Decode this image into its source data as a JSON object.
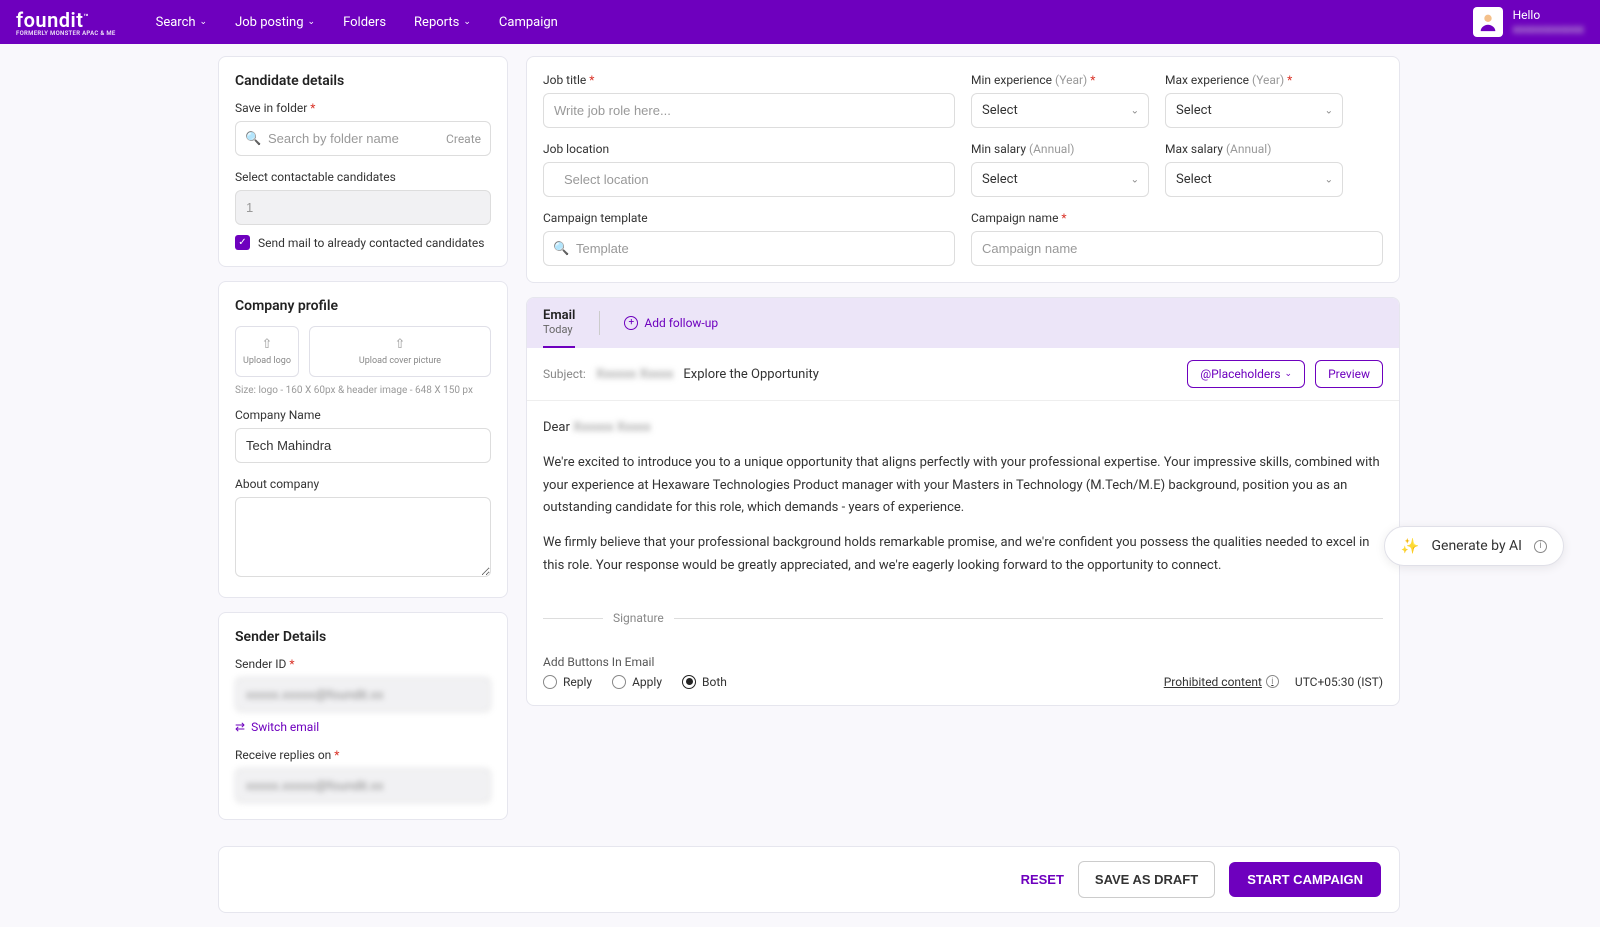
{
  "brand": {
    "name": "foundit",
    "tagline": "FORMERLY MONSTER APAC & ME"
  },
  "nav": {
    "search": "Search",
    "jobposting": "Job posting",
    "folders": "Folders",
    "reports": "Reports",
    "campaign": "Campaign"
  },
  "profile": {
    "greeting": "Hello",
    "name_blurred": "xxxxxxxxxxxx"
  },
  "left": {
    "candidate": {
      "title": "Candidate details",
      "save_label": "Save in folder",
      "search_placeholder": "Search by folder name",
      "create": "Create",
      "contactable_label": "Select contactable candidates",
      "contactable_value": "1",
      "sendmail_label": "Send mail to already contacted candidates"
    },
    "company": {
      "title": "Company profile",
      "upload_logo": "Upload logo",
      "upload_cover": "Upload cover picture",
      "size_hint": "Size: logo - 160 X 60px & header image - 648 X 150 px",
      "name_label": "Company Name",
      "name_value": "Tech Mahindra",
      "about_label": "About company"
    },
    "sender": {
      "title": "Sender Details",
      "id_label": "Sender ID",
      "id_blurred": "xxxxx.xxxxx@foundit.xx",
      "switch": "Switch email",
      "receive_label": "Receive replies on",
      "receive_blurred": "xxxxx.xxxxx@foundit.xx"
    }
  },
  "form": {
    "job_title": {
      "label": "Job title",
      "placeholder": "Write job role here..."
    },
    "job_location": {
      "label": "Job location",
      "placeholder": "Select location"
    },
    "min_exp": {
      "label": "Min experience",
      "unit": "(Year)",
      "value": "Select"
    },
    "max_exp": {
      "label": "Max experience",
      "unit": "(Year)",
      "value": "Select"
    },
    "min_sal": {
      "label": "Min salary",
      "unit": "(Annual)",
      "value": "Select"
    },
    "max_sal": {
      "label": "Max salary",
      "unit": "(Annual)",
      "value": "Select"
    },
    "template": {
      "label": "Campaign template",
      "placeholder": "Template"
    },
    "name": {
      "label": "Campaign name",
      "placeholder": "Campaign name"
    }
  },
  "email": {
    "tab_title": "Email",
    "tab_sub": "Today",
    "add_follow": "Add follow-up",
    "subject_label": "Subject:",
    "subject_blurred": "Xxxxxx Xxxxx",
    "subject_text": "Explore the Opportunity",
    "placeholders_btn": "@Placeholders",
    "preview_btn": "Preview",
    "greeting": "Dear",
    "greeting_blurred": "Xxxxxx Xxxxx",
    "para1": "We're excited to introduce you to a unique opportunity that aligns perfectly with your professional expertise. Your impressive skills, combined with your experience at Hexaware Technologies Product manager with your Masters in Technology (M.Tech/M.E) background, position you as an outstanding candidate for this role, which demands - years of experience.",
    "para2": "We firmly believe that your professional background holds remarkable promise, and we're confident you possess the qualities needed to excel in this role. Your response would be greatly appreciated, and we're eagerly looking forward to the opportunity to connect.",
    "signature": "Signature",
    "buttons_label": "Add Buttons In Email",
    "reply": "Reply",
    "apply": "Apply",
    "both": "Both",
    "prohibited": "Prohibited content",
    "tz": "UTC+05:30 (IST)"
  },
  "actions": {
    "reset": "RESET",
    "draft": "SAVE AS DRAFT",
    "start": "START CAMPAIGN"
  },
  "ai": {
    "label": "Generate by AI"
  }
}
